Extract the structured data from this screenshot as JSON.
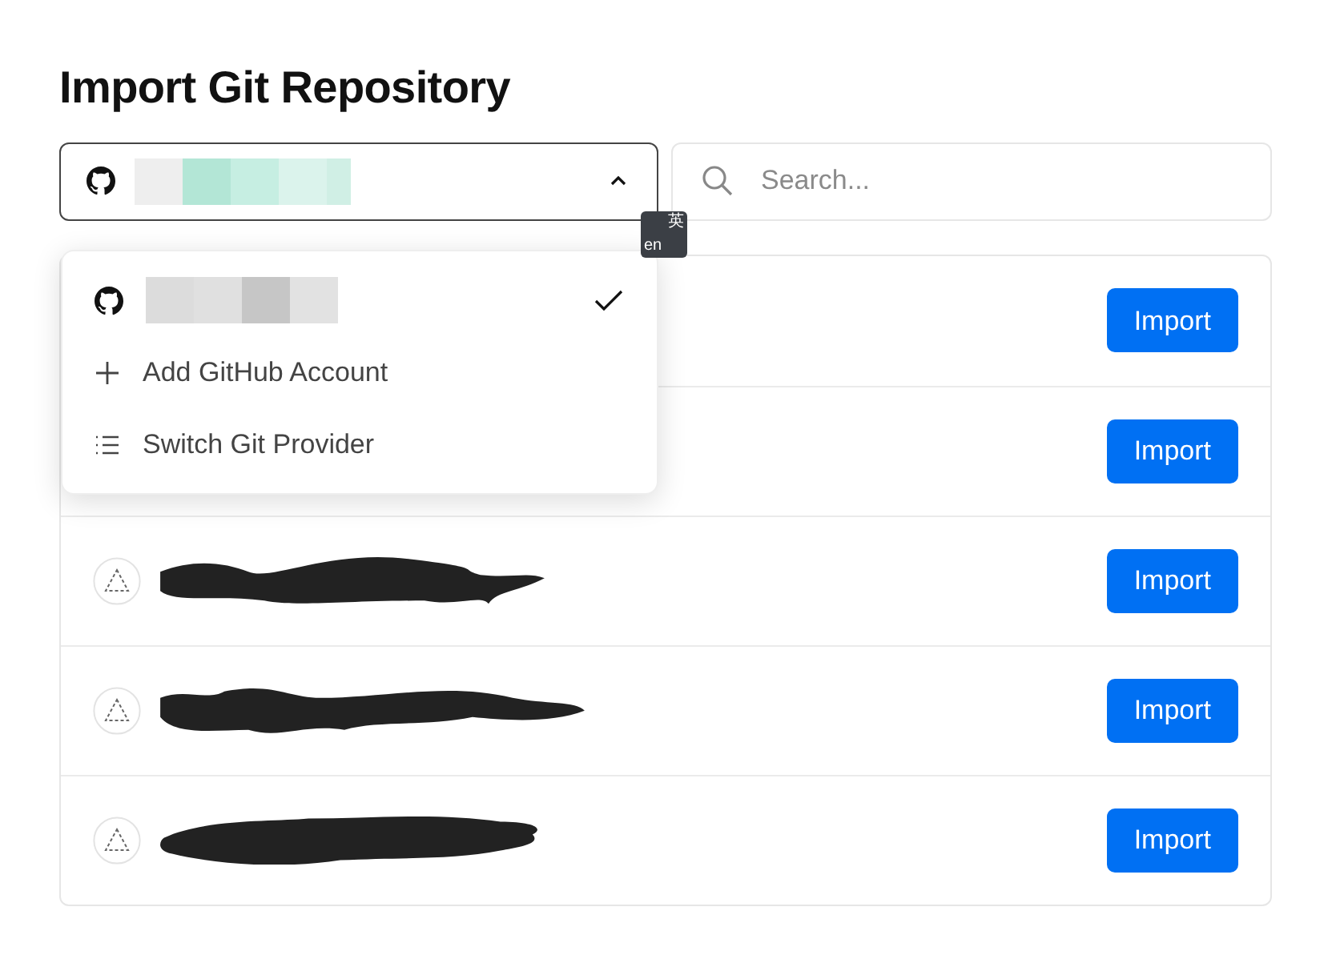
{
  "title": "Import Git Repository",
  "account_select": {
    "expanded": true
  },
  "search": {
    "placeholder": "Search..."
  },
  "ime_indicator": {
    "top": "英",
    "bottom": "en"
  },
  "menu": [
    {
      "kind": "account",
      "selected": true
    },
    {
      "kind": "add",
      "label": "Add GitHub Account"
    },
    {
      "kind": "switch",
      "label": "Switch Git Provider"
    }
  ],
  "repos": [
    {
      "kind": "covered",
      "button": "Import"
    },
    {
      "kind": "covered",
      "button": "Import"
    },
    {
      "kind": "repo",
      "button": "Import"
    },
    {
      "kind": "repo",
      "button": "Import"
    },
    {
      "kind": "repo",
      "button": "Import"
    }
  ]
}
